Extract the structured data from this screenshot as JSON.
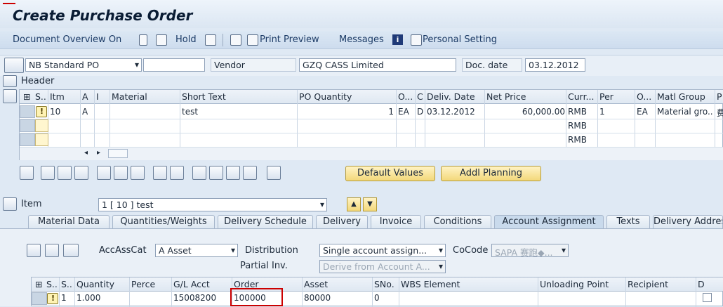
{
  "window": {
    "title": "Create Purchase Order"
  },
  "toolbar": {
    "document_overview": "Document Overview On",
    "hold": "Hold",
    "print_preview": "Print Preview",
    "messages": "Messages",
    "personal_setting": "Personal Setting"
  },
  "header": {
    "doc_type": "NB Standard PO",
    "doc_number": "",
    "vendor_label": "Vendor",
    "vendor_value": "GZQ CASS Limited",
    "doc_date_label": "Doc. date",
    "doc_date_value": "03.12.2012",
    "header_label": "Header"
  },
  "items_table": {
    "columns": [
      "S..",
      "Itm",
      "A",
      "I",
      "Material",
      "Short Text",
      "PO Quantity",
      "O...",
      "C",
      "Deliv. Date",
      "Net Price",
      "Curr...",
      "Per",
      "O...",
      "Matl Group",
      "P"
    ],
    "rows": [
      {
        "itm": "10",
        "a": "A",
        "short_text": "test",
        "po_qty": "1",
        "unit": "EA",
        "c": "D",
        "deliv_date": "03.12.2012",
        "net_price": "60,000.00",
        "curr": "RMB",
        "per": "1",
        "order_unit": "EA",
        "matl_group": "Material gro...",
        "p": "费"
      },
      {
        "curr": "RMB"
      },
      {
        "curr": "RMB"
      }
    ]
  },
  "buttons": {
    "default_values": "Default Values",
    "addl_planning": "Addl Planning"
  },
  "item_section": {
    "label": "Item",
    "selected": "1 [ 10 ] test"
  },
  "tabs": [
    "Material Data",
    "Quantities/Weights",
    "Delivery Schedule",
    "Delivery",
    "Invoice",
    "Conditions",
    "Account Assignment",
    "Texts",
    "Delivery Address"
  ],
  "active_tab": "Account Assignment",
  "account": {
    "accasscat_label": "AccAssCat",
    "accasscat_value": "A Asset",
    "distribution_label": "Distribution",
    "distribution_value": "Single account assign...",
    "cocode_label": "CoCode",
    "cocode_value": "SAPA 赛跑◆...",
    "partial_inv_label": "Partial Inv.",
    "partial_inv_value": "Derive from Account A..."
  },
  "acct_table": {
    "columns": [
      "S..",
      "S..",
      "Quantity",
      "Perce",
      "G/L Acct",
      "Order",
      "Asset",
      "SNo.",
      "WBS Element",
      "Unloading Point",
      "Recipient",
      "D"
    ],
    "row": {
      "s2": "1",
      "quantity": "1.000",
      "perce": "",
      "gl_acct": "15008200",
      "order": "100000",
      "asset": "80000",
      "sno": "0"
    }
  },
  "colors": {
    "accent": "#cc0000",
    "bg": "#dfe9f4",
    "yellow": "#f3d87a"
  }
}
